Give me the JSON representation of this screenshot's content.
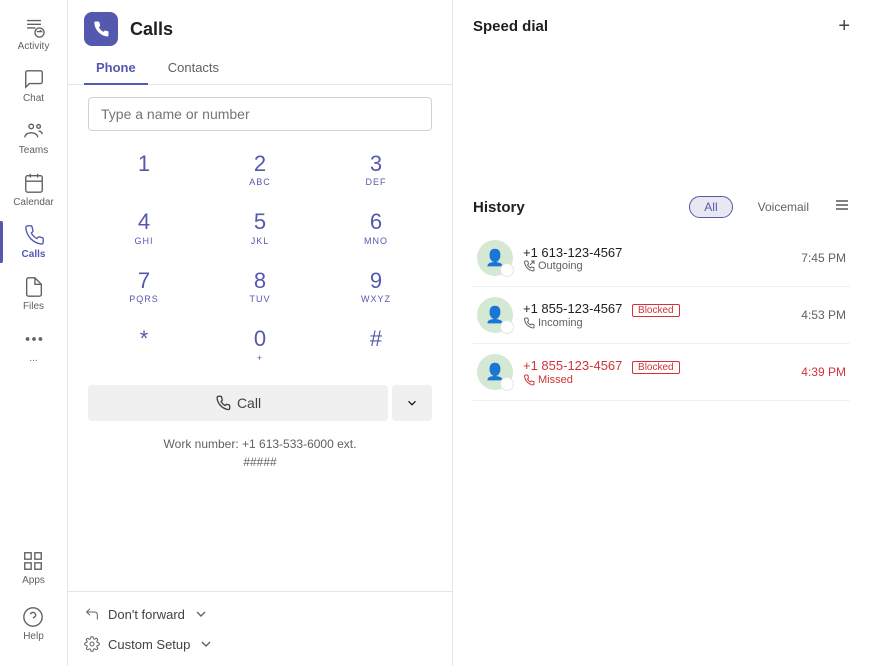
{
  "sidebar": {
    "items": [
      {
        "label": "Activity",
        "icon": "activity-icon"
      },
      {
        "label": "Chat",
        "icon": "chat-icon"
      },
      {
        "label": "Teams",
        "icon": "teams-icon"
      },
      {
        "label": "Calendar",
        "icon": "calendar-icon"
      },
      {
        "label": "Calls",
        "icon": "calls-icon",
        "active": true
      },
      {
        "label": "Files",
        "icon": "files-icon"
      },
      {
        "label": "...",
        "icon": "more-icon"
      }
    ],
    "bottom": [
      {
        "label": "Apps",
        "icon": "apps-icon"
      },
      {
        "label": "Help",
        "icon": "help-icon"
      }
    ]
  },
  "calls": {
    "title": "Calls",
    "tabs": [
      {
        "label": "Phone",
        "active": true
      },
      {
        "label": "Contacts",
        "active": false
      }
    ],
    "dialpad": {
      "placeholder": "Type a name or number",
      "keys": [
        {
          "num": "1",
          "letters": ""
        },
        {
          "num": "2",
          "letters": "ABC"
        },
        {
          "num": "3",
          "letters": "DEF"
        },
        {
          "num": "4",
          "letters": "GHI"
        },
        {
          "num": "5",
          "letters": "JKL"
        },
        {
          "num": "6",
          "letters": "MNO"
        },
        {
          "num": "7",
          "letters": "PQRS"
        },
        {
          "num": "8",
          "letters": "TUV"
        },
        {
          "num": "9",
          "letters": "WXYZ"
        },
        {
          "num": "*",
          "letters": ""
        },
        {
          "num": "0",
          "letters": "+"
        },
        {
          "num": "#",
          "letters": ""
        }
      ],
      "call_button": "Call",
      "work_number_label": "Work number: +1 613-533-6000 ext.",
      "work_number_ext": "#####"
    },
    "bottom_options": [
      {
        "label": "Don't forward",
        "has_arrow": true
      },
      {
        "label": "Custom Setup",
        "has_arrow": true
      }
    ]
  },
  "speed_dial": {
    "title": "Speed dial",
    "add_label": "+"
  },
  "history": {
    "title": "History",
    "filter_all": "All",
    "filter_voicemail": "Voicemail",
    "items": [
      {
        "number": "+1 613-123-4567",
        "type": "Outgoing",
        "time": "7:45 PM",
        "blocked": false,
        "missed": false
      },
      {
        "number": "+1 855-123-4567",
        "type": "Incoming",
        "time": "4:53 PM",
        "blocked": true,
        "missed": false
      },
      {
        "number": "+1 855-123-4567",
        "type": "Missed",
        "time": "4:39 PM",
        "blocked": true,
        "missed": true
      }
    ],
    "blocked_label": "Blocked"
  }
}
